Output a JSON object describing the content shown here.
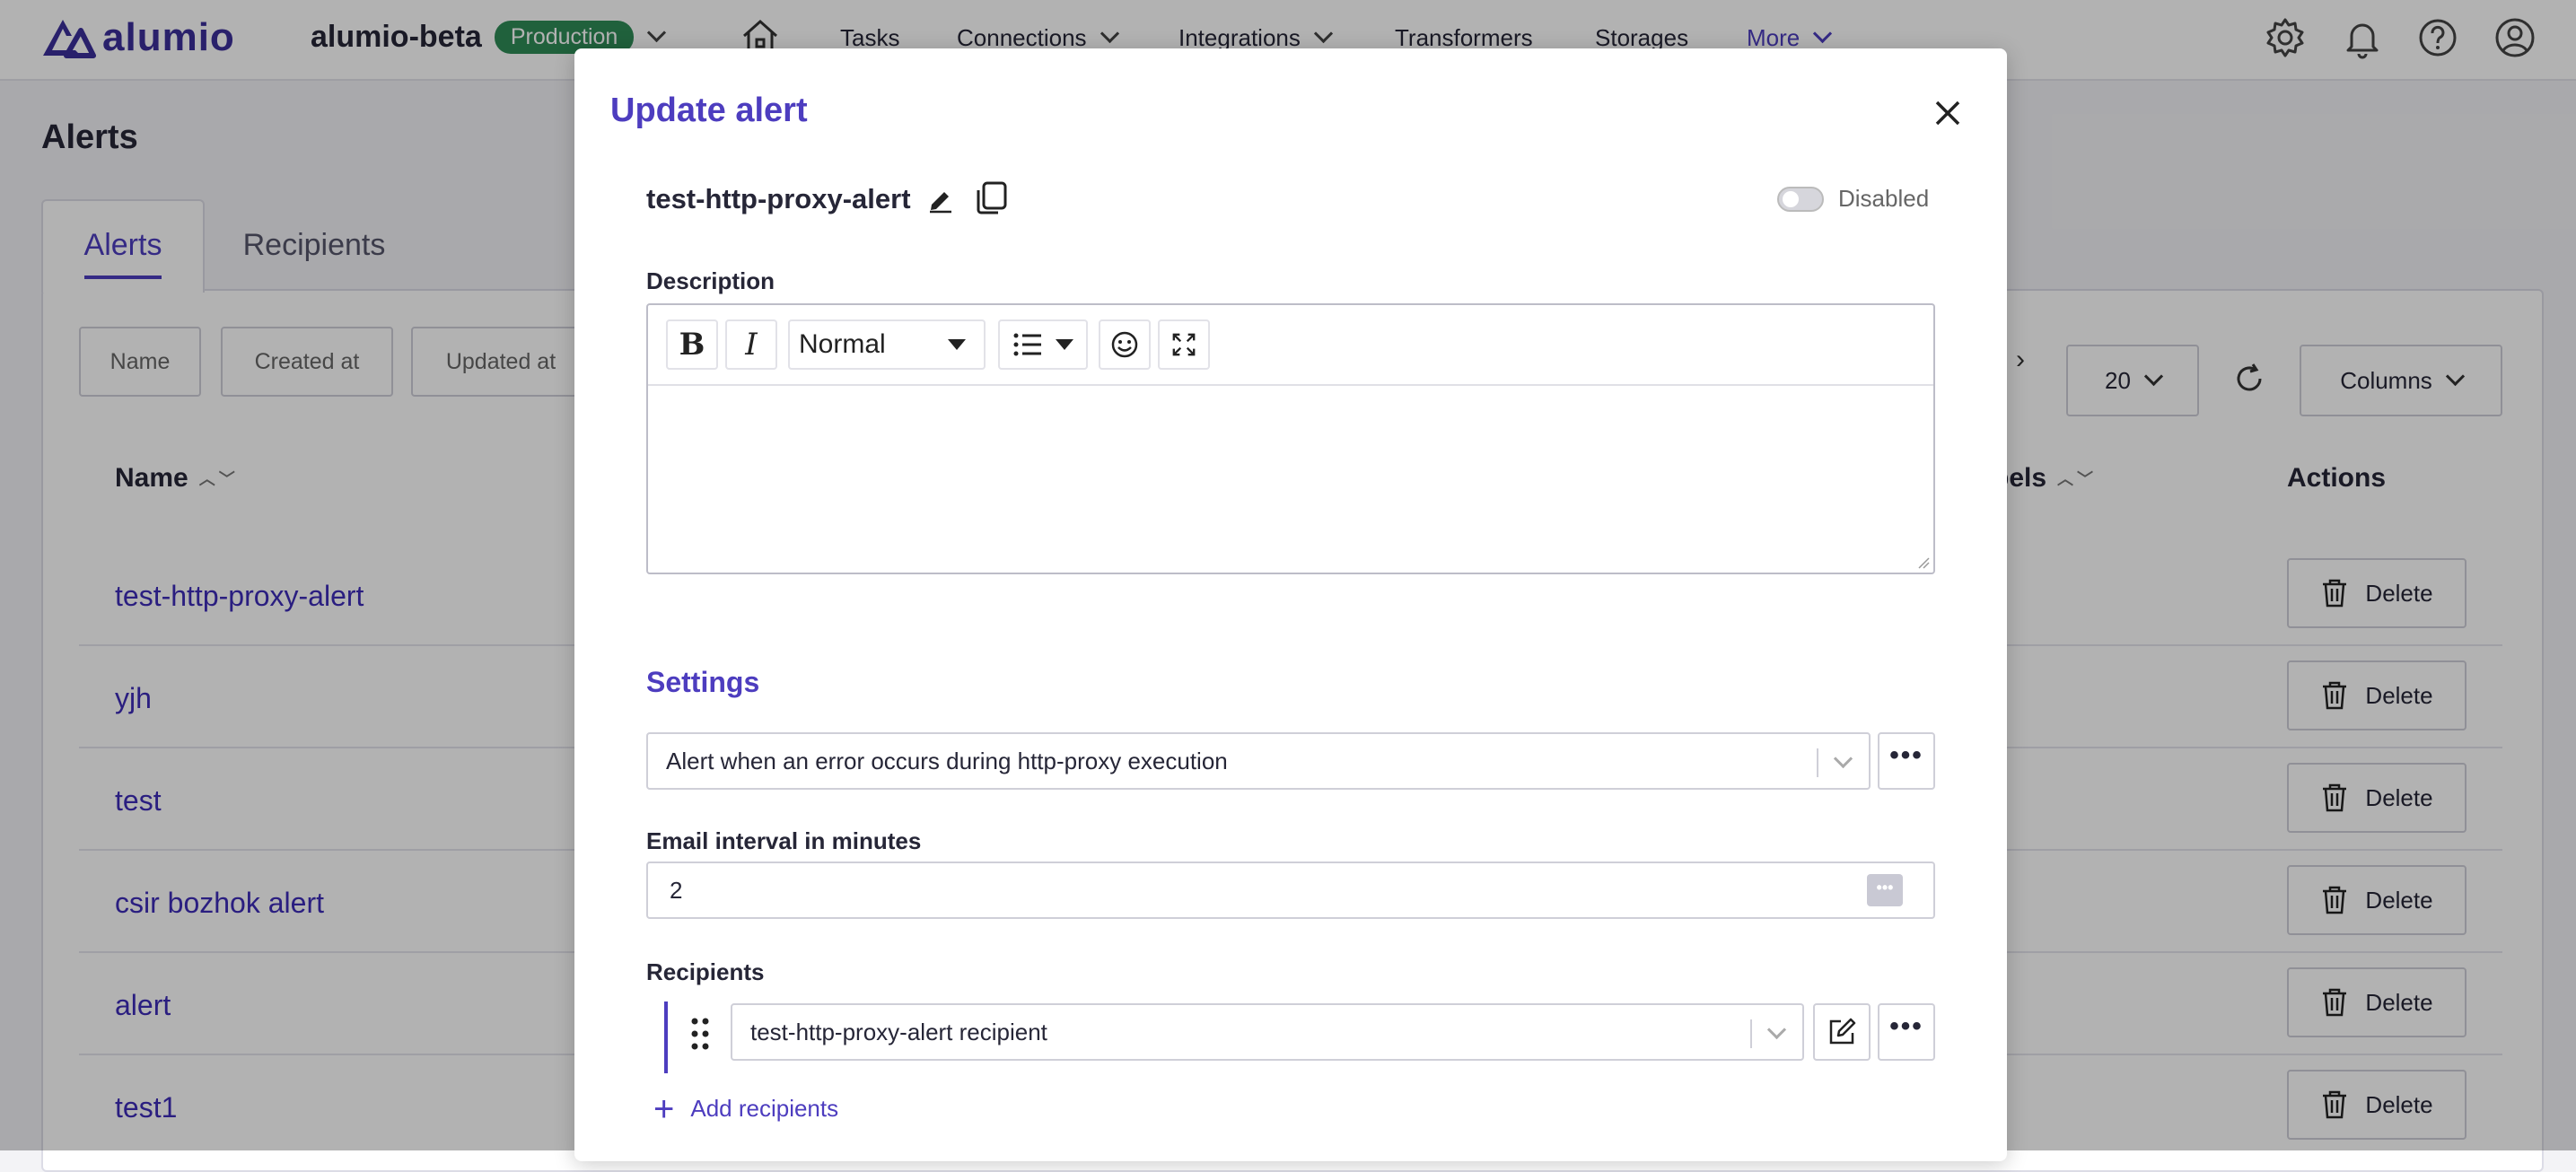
{
  "brand": {
    "name": "alumio"
  },
  "env": {
    "name": "alumio-beta",
    "badge": "Production"
  },
  "nav": {
    "tasks": "Tasks",
    "connections": "Connections",
    "integrations": "Integrations",
    "transformers": "Transformers",
    "storages": "Storages",
    "more": "More"
  },
  "page": {
    "title": "Alerts",
    "tabs": {
      "alerts": "Alerts",
      "recipients": "Recipients"
    },
    "filters": {
      "name": "Name",
      "created_at": "Created at",
      "updated_at": "Updated at"
    },
    "page_size": "20",
    "columns_label": "Columns",
    "columns": {
      "name": "Name",
      "labels_partial": "bels",
      "actions": "Actions"
    },
    "rows": [
      "test-http-proxy-alert",
      "yjh",
      "test",
      "csir bozhok alert",
      "alert",
      "test1"
    ],
    "delete_label": "Delete"
  },
  "modal": {
    "title": "Update alert",
    "alert_name": "test-http-proxy-alert",
    "toggle_label": "Disabled",
    "description_label": "Description",
    "editor": {
      "heading_select": "Normal",
      "content": ""
    },
    "settings_title": "Settings",
    "alert_type": "Alert when an error occurs during http-proxy execution",
    "email_interval_label": "Email interval in minutes",
    "email_interval_value": "2",
    "recipients_label": "Recipients",
    "recipient_value": "test-http-proxy-alert recipient",
    "add_recipients": "Add recipients"
  },
  "colors": {
    "accent": "#4d3dbf",
    "badge": "#2e8b57"
  }
}
